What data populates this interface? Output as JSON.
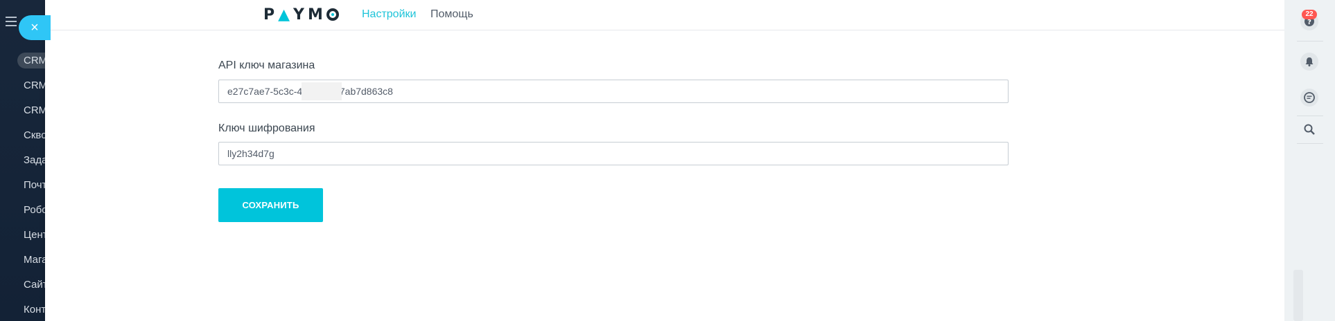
{
  "sidebar": {
    "items": [
      {
        "label": "CRM"
      },
      {
        "label": "CRM"
      },
      {
        "label": "CRM"
      },
      {
        "label": "Скво"
      },
      {
        "label": "Зада"
      },
      {
        "label": "Почт"
      },
      {
        "label": "Робо"
      },
      {
        "label": "Цент"
      },
      {
        "label": "Мага"
      },
      {
        "label": "Сайт"
      },
      {
        "label": "Конт"
      }
    ]
  },
  "close_icon": "×",
  "header": {
    "logo": {
      "p": "P",
      "a": "▲",
      "y": "Y",
      "m": "M"
    },
    "nav": {
      "settings": "Настройки",
      "help": "Помощь"
    }
  },
  "form": {
    "api_key": {
      "label": "API ключ магазина",
      "value": "e27c7ae7-5c3c-4          ac7ab7d863c8"
    },
    "encryption_key": {
      "label": "Ключ шифрования",
      "value": "lly2h34d7g"
    },
    "save_label": "СОХРАНИТЬ"
  },
  "right_bar": {
    "help_badge": "22",
    "icons": [
      "help-icon",
      "bell-icon",
      "chat-icon",
      "search-icon"
    ]
  },
  "colors": {
    "accent": "#00c4db",
    "sidebar_bg": "#18273b",
    "badge": "#ff5752"
  }
}
